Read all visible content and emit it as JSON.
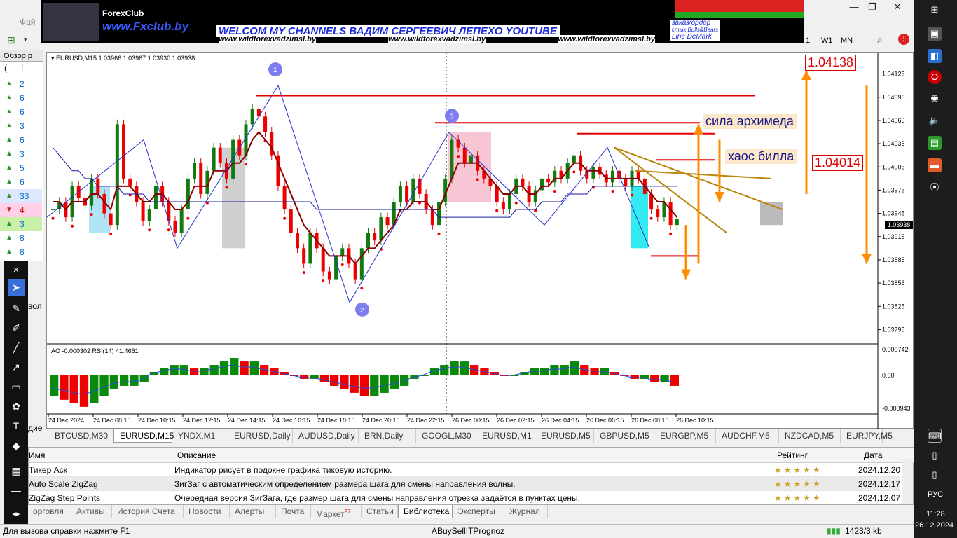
{
  "app": {
    "menu_partial": "Фай",
    "timeframes": [
      "1",
      "W1",
      "MN"
    ]
  },
  "banner": {
    "logo": "ForexClub",
    "fxclub": "www.Fxclub.by",
    "title": "WELCOM MY CHANNELS ВАДИМ СЕРГЕЕВИЧ ЛЕПЕХО YOUTUBE",
    "site1": "www.wildforexvadzimsl.by",
    "site2": "www.wildforexvadzimsl.by",
    "site3": "www.wildforexvadzimsl.by",
    "right_line1": "заказ/ордер",
    "right_line2": "стык Bulls&Bears",
    "right_line3": "Line DeMark"
  },
  "market_watch": {
    "header": "Обзор р",
    "col1": "(",
    "col2": "!",
    "rows": [
      {
        "dir": "up",
        "value": "2"
      },
      {
        "dir": "up",
        "value": "6"
      },
      {
        "dir": "up",
        "value": "6"
      },
      {
        "dir": "up",
        "value": "3"
      },
      {
        "dir": "up",
        "value": "6"
      },
      {
        "dir": "up",
        "value": "3"
      },
      {
        "dir": "up",
        "value": "5"
      },
      {
        "dir": "up",
        "value": "6"
      },
      {
        "dir": "up",
        "value": "33"
      },
      {
        "dir": "down",
        "value": "4"
      },
      {
        "dir": "up",
        "value": "3"
      },
      {
        "dir": "up",
        "value": "8"
      },
      {
        "dir": "up",
        "value": "8"
      }
    ],
    "partial_label": "вол",
    "partial_label2": "дие"
  },
  "chart": {
    "symbol_info": "EURUSD,M15  1.03966 1.03967 1.03930 1.03938",
    "indicator_info": "AO -0.000302  RSI(14) 41.4661",
    "current_price": "1.03938",
    "annotations": {
      "sila": "сила архимеда",
      "haos": "хаос билла",
      "price_top": "1.04138",
      "price_mid": "1.04014"
    },
    "wave_labels": [
      "1",
      "2",
      "3"
    ]
  },
  "chart_data": {
    "type": "line",
    "title": "",
    "price_axis_ticks": [
      "1.04125",
      "1.04095",
      "1.04065",
      "1.04035",
      "1.04005",
      "1.03975",
      "1.03945",
      "1.03915",
      "1.03885",
      "1.03855",
      "1.03825",
      "1.03795"
    ],
    "ylim": [
      1.0378,
      1.0414
    ],
    "indicator_axis_ticks": [
      "0.000742",
      "0.00",
      "-0.000943"
    ],
    "time_axis_ticks": [
      "24 Dec 2024",
      "24 Dec 08:15",
      "24 Dec 10:15",
      "24 Dec 12:15",
      "24 Dec 14:15",
      "24 Dec 16:15",
      "24 Dec 18:15",
      "24 Dec 20:15",
      "24 Dec 22:15",
      "26 Dec 00:15",
      "26 Dec 02:15",
      "26 Dec 04:15",
      "26 Dec 06:15",
      "26 Dec 08:15",
      "26 Dec 10:15"
    ],
    "close_series": [
      1.0395,
      1.0396,
      1.0394,
      1.0398,
      1.03965,
      1.03955,
      1.0399,
      1.0397,
      1.03945,
      1.0393,
      1.0406,
      1.0399,
      1.0398,
      1.0396,
      1.03935,
      1.0395,
      1.0398,
      1.0396,
      1.03935,
      1.0392,
      1.0395,
      1.0399,
      1.0401,
      1.0397,
      1.04,
      1.0403,
      1.0401,
      1.0399,
      1.0404,
      1.0402,
      1.0406,
      1.0408,
      1.0407,
      1.0405,
      1.0402,
      1.0398,
      1.0395,
      1.0392,
      1.039,
      1.0388,
      1.0392,
      1.039,
      1.0387,
      1.0386,
      1.0389,
      1.039,
      1.0388,
      1.0386,
      1.039,
      1.0392,
      1.0391,
      1.0394,
      1.0393,
      1.0396,
      1.0398,
      1.0396,
      1.0399,
      1.0397,
      1.0395,
      1.0393,
      1.0396,
      1.0399,
      1.0404,
      1.0403,
      1.0401,
      1.0402,
      1.04,
      1.0399,
      1.0398,
      1.0396,
      1.0395,
      1.0397,
      1.0399,
      1.0398,
      1.0396,
      1.03975,
      1.0399,
      1.03985,
      1.04,
      1.0399,
      1.0401,
      1.0402,
      1.04,
      1.0399,
      1.04005,
      1.03995,
      1.03985,
      1.04,
      1.0399,
      1.0398,
      1.04,
      1.0399,
      1.0397,
      1.0395,
      1.0394,
      1.0396,
      1.0393,
      1.03938
    ],
    "ma_fast": [
      1.0396,
      1.0396,
      1.0395,
      1.0396,
      1.0396,
      1.0396,
      1.0397,
      1.0397,
      1.0396,
      1.0395,
      1.0398,
      1.0398,
      1.0398,
      1.0397,
      1.0396,
      1.0396,
      1.0397,
      1.0397,
      1.0396,
      1.0395,
      1.0395,
      1.0396,
      1.0398,
      1.0398,
      1.0398,
      1.04,
      1.04,
      1.04,
      1.0401,
      1.0401,
      1.0402,
      1.0404,
      1.0405,
      1.0404,
      1.0403,
      1.0401,
      1.0399,
      1.0397,
      1.0395,
      1.0393,
      1.0392,
      1.0391,
      1.039,
      1.0389,
      1.0389,
      1.0389,
      1.0389,
      1.0388,
      1.0389,
      1.039,
      1.039,
      1.0391,
      1.0392,
      1.0393,
      1.0395,
      1.0395,
      1.0396,
      1.0396,
      1.0396,
      1.0395,
      1.0395,
      1.0397,
      1.0399,
      1.0401,
      1.0401,
      1.0401,
      1.0401,
      1.04,
      1.0399,
      1.0398,
      1.0397,
      1.0397,
      1.0398,
      1.0398,
      1.0397,
      1.0397,
      1.0398,
      1.0398,
      1.0399,
      1.0399,
      1.04,
      1.0401,
      1.0401,
      1.04,
      1.04,
      1.04,
      1.0399,
      1.0399,
      1.0399,
      1.0399,
      1.0399,
      1.0399,
      1.0398,
      1.0397,
      1.0396,
      1.0396,
      1.0395,
      1.0394
    ],
    "ma_slow": [
      1.0403,
      1.0402,
      1.0401,
      1.04,
      1.04,
      1.0399,
      1.0399,
      1.0398,
      1.0398,
      1.0398,
      1.0398,
      1.0397,
      1.0397,
      1.0397,
      1.0397,
      1.0396,
      1.0396,
      1.0396,
      1.0396,
      1.0396,
      1.0396,
      1.0396,
      1.0396,
      1.0396,
      1.0396,
      1.0396,
      1.0396,
      1.0396,
      1.0396,
      1.0396,
      1.0396,
      1.0396,
      1.0396,
      1.0396,
      1.0396,
      1.0396,
      1.0396,
      1.0396,
      1.0396,
      1.0396,
      1.0396,
      1.0395,
      1.0395,
      1.0395,
      1.0395,
      1.0395,
      1.0395,
      1.0395,
      1.0395,
      1.0395,
      1.0395,
      1.0395,
      1.0395,
      1.0395,
      1.0395,
      1.0395,
      1.0395,
      1.0395,
      1.0395,
      1.0395,
      1.0394,
      1.0394,
      1.0394,
      1.0394,
      1.0394,
      1.0394,
      1.0394,
      1.0394,
      1.0394,
      1.0394,
      1.0394,
      1.0394,
      1.0395,
      1.0395,
      1.0395,
      1.0395,
      1.0396,
      1.0396,
      1.0396,
      1.0396,
      1.0397,
      1.0397,
      1.0397,
      1.0397,
      1.0398,
      1.0398,
      1.0398,
      1.0398,
      1.0398,
      1.0398,
      1.0398,
      1.0398,
      1.0398,
      1.0398,
      1.0398,
      1.0398,
      1.0398,
      1.0398
    ],
    "ao_series": [
      -0.0006,
      -0.0007,
      -0.0008,
      -0.0009,
      -0.0008,
      -0.0006,
      -0.0004,
      -0.0003,
      -0.0003,
      -0.0002,
      0.0001,
      0.0002,
      0.0003,
      0.0003,
      0.0002,
      0.0002,
      0.0003,
      0.0004,
      0.0005,
      0.0004,
      0.0004,
      0.0003,
      0.0002,
      0.0001,
      0.0,
      -0.0001,
      -0.0001,
      -0.0002,
      -0.0003,
      -0.0004,
      -0.0005,
      -0.0006,
      -0.0006,
      -0.0005,
      -0.0004,
      -0.0003,
      -0.0001,
      0.0,
      0.0002,
      0.0003,
      0.0004,
      0.0004,
      0.0003,
      0.0002,
      0.0001,
      0.0,
      0.0,
      0.0001,
      0.0002,
      0.0002,
      0.0003,
      0.0003,
      0.0004,
      0.0003,
      0.0002,
      0.0002,
      0.0001,
      0.0,
      -0.0001,
      -0.0001,
      -0.0002,
      -0.0002,
      -0.0003
    ]
  },
  "symbol_tabs": [
    {
      "label": "BTCUSD,M30",
      "active": false
    },
    {
      "label": "EURUSD,M15",
      "active": true
    },
    {
      "label": "YNDX,M1",
      "active": false
    },
    {
      "label": "EURUSD,Daily",
      "active": false
    },
    {
      "label": "AUDUSD,Daily",
      "active": false
    },
    {
      "label": "BRN,Daily",
      "active": false
    },
    {
      "label": "GOOGL,M30",
      "active": false
    },
    {
      "label": "EURUSD,M1",
      "active": false
    },
    {
      "label": "EURUSD,M5",
      "active": false
    },
    {
      "label": "GBPUSD,M5",
      "active": false
    },
    {
      "label": "EURGBP,M5",
      "active": false
    },
    {
      "label": "AUDCHF,M5",
      "active": false
    },
    {
      "label": "NZDCAD,M5",
      "active": false
    },
    {
      "label": "EURJPY,M5",
      "active": false
    }
  ],
  "library": {
    "headers": {
      "name": "Имя",
      "desc": "Описание",
      "rating": "Рейтинг",
      "date": "Дата"
    },
    "rows": [
      {
        "name": "Тикер Аск",
        "desc": "Индикатор рисует в подокне графика тиковую историю.",
        "stars": "★★★★★",
        "date": "2024.12.20"
      },
      {
        "name": "Auto Scale ZigZag",
        "desc": "ЗигЗаг с автоматическим определением размера шага для смены направления волны.",
        "stars": "★★★★★",
        "date": "2024.12.17"
      },
      {
        "name": "ZigZag Step Points",
        "desc": "Очередная версия ЗигЗага, где размер шага для смены направления отрезка задаётся в пунктах цены.",
        "stars": "★★★★★",
        "date": "2024.12.07"
      }
    ]
  },
  "bottom_tabs": [
    {
      "label": "орговля",
      "active": false
    },
    {
      "label": "Активы",
      "active": false
    },
    {
      "label": "История Счета",
      "active": false
    },
    {
      "label": "Новости",
      "active": false
    },
    {
      "label": "Алерты",
      "active": false
    },
    {
      "label": "Почта",
      "active": false
    },
    {
      "label": "Маркет",
      "badge": "97",
      "active": false
    },
    {
      "label": "Статьи",
      "active": false
    },
    {
      "label": "Библиотека",
      "active": true
    },
    {
      "label": "Эксперты",
      "active": false
    },
    {
      "label": "Журнал",
      "active": false
    }
  ],
  "status": {
    "help": "Для вызова справки нажмите F1",
    "profile": "ABuySellITPrognoz",
    "traffic": "1423/3 kb"
  },
  "taskbar": {
    "lang": "РУС",
    "time": "11:28",
    "date": "26.12.2024"
  }
}
